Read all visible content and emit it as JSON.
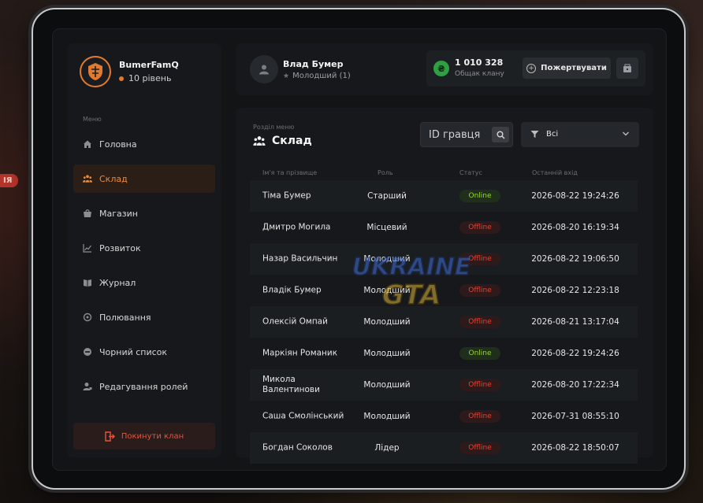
{
  "background": {
    "side_tag": "ІЯ"
  },
  "profile": {
    "name": "BumerFamQ",
    "level": "10 рівень"
  },
  "menu": {
    "caption": "Меню",
    "items": [
      {
        "label": "Головна",
        "icon": "home-icon",
        "active": false
      },
      {
        "label": "Склад",
        "icon": "people-icon",
        "active": true
      },
      {
        "label": "Магазин",
        "icon": "shop-icon",
        "active": false
      },
      {
        "label": "Розвиток",
        "icon": "chart-icon",
        "active": false
      },
      {
        "label": "Журнал",
        "icon": "book-icon",
        "active": false
      },
      {
        "label": "Полювання",
        "icon": "target-icon",
        "active": false
      },
      {
        "label": "Чорний список",
        "icon": "block-icon",
        "active": false
      },
      {
        "label": "Редагування ролей",
        "icon": "user-edit-icon",
        "active": false
      }
    ],
    "leave": "Покинути клан"
  },
  "user": {
    "name": "Влад Бумер",
    "role": "Молодший (1)"
  },
  "bank": {
    "amount": "1 010 328",
    "caption": "Общак клану",
    "coin_symbol": "₴",
    "donate": "Пожертвувати"
  },
  "section": {
    "caption": "Розділ меню",
    "title": "Склад"
  },
  "search": {
    "placeholder": "ID гравця"
  },
  "filter": {
    "value": "Всі"
  },
  "table": {
    "headers": {
      "name": "Ім'я та прізвище",
      "role": "Роль",
      "status": "Статус",
      "last": "Останній вхід"
    },
    "rows": [
      {
        "name": "Тіма Бумер",
        "role": "Старший",
        "status": "Online",
        "date": "2026-08-22 19:24:26"
      },
      {
        "name": "Дмитро Могила",
        "role": "Місцевий",
        "status": "Offline",
        "date": "2026-08-20 16:19:34"
      },
      {
        "name": "Назар Васильчин",
        "role": "Молодший",
        "status": "Offline",
        "date": "2026-08-22 19:06:50"
      },
      {
        "name": "Владік Бумер",
        "role": "Молодший",
        "status": "Offline",
        "date": "2026-08-22 12:23:18"
      },
      {
        "name": "Олексій Омпай",
        "role": "Молодший",
        "status": "Offline",
        "date": "2026-08-21 13:17:04"
      },
      {
        "name": "Маркіян Романик",
        "role": "Молодший",
        "status": "Online",
        "date": "2026-08-22 19:24:26"
      },
      {
        "name": "Микола Валентинови",
        "role": "Молодший",
        "status": "Offline",
        "date": "2026-08-20 17:22:34"
      },
      {
        "name": "Саша Смолінський",
        "role": "Молодший",
        "status": "Offline",
        "date": "2026-07-31 08:55:10"
      },
      {
        "name": "Богдан Соколов",
        "role": "Лідер",
        "status": "Offline",
        "date": "2026-08-22 18:50:07"
      }
    ]
  },
  "watermark": {
    "line1": "UKRAINE",
    "line2": "GTA"
  },
  "colors": {
    "accent": "#e07a2e",
    "online": "#9bd43c",
    "offline": "#d9473a",
    "coin": "#2ea043"
  }
}
